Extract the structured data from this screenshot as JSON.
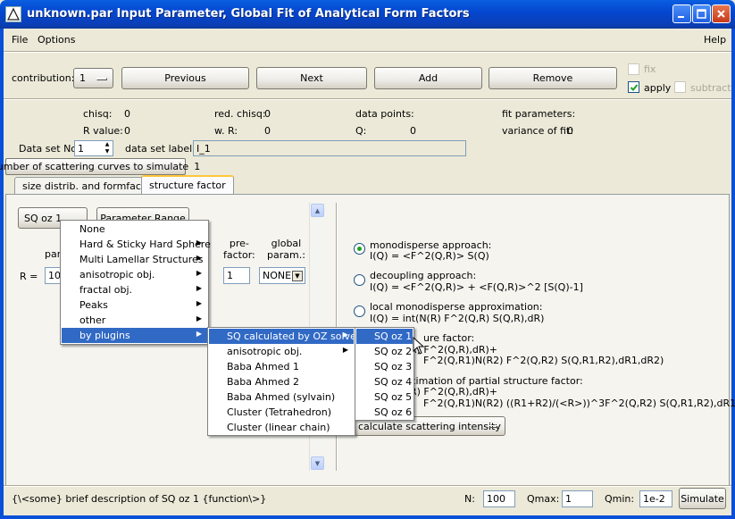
{
  "window": {
    "title": "unknown.par Input Parameter, Global Fit of Analytical Form Factors"
  },
  "menu": {
    "file": "File",
    "options": "Options",
    "help": "Help"
  },
  "top": {
    "contribution_label": "contribution:",
    "contribution_value": "1",
    "previous": "Previous",
    "next": "Next",
    "add": "Add",
    "remove": "Remove",
    "fix": "fix",
    "apply": "apply",
    "subtract": "subtract"
  },
  "stats": {
    "chisq_label": "chisq:",
    "chisq_value": "0",
    "red_chisq_label": "red. chisq:",
    "red_chisq_value": "0",
    "data_points_label": "data points:",
    "fit_parameters_label": "fit parameters:",
    "r_value_label": "R value:",
    "r_value": "0",
    "wr_label": "w. R:",
    "wr_value": "0",
    "q_label": "Q:",
    "q_value": "0",
    "variance_label": "variance of fit:",
    "variance_value": "0"
  },
  "dataset": {
    "no_label": "Data set No:",
    "no_value": "1",
    "label_label": "data set label:",
    "label_value": "I_1",
    "num_curves_label": "number of scattering curves to simulate",
    "num_curves_value": "1"
  },
  "tabs": [
    {
      "label": "size distrib. and formfactor"
    },
    {
      "label": "structure factor"
    }
  ],
  "sq": {
    "selected": "SQ oz 1",
    "parameter_range": "Parameter Range",
    "par_label_partial": "par",
    "r_label": "R =",
    "r_value": "10",
    "prefactor_label": "pre-\nfactor:",
    "prefactor_value": "1",
    "global_label": "global\nparam.:",
    "global_value": "NONE"
  },
  "menu_level1": [
    {
      "label": "None",
      "submenu": false
    },
    {
      "label": "Hard & Sticky Hard Sphere",
      "submenu": true
    },
    {
      "label": "Multi Lamellar Structures",
      "submenu": true
    },
    {
      "label": "anisotropic obj.",
      "submenu": true
    },
    {
      "label": "fractal obj.",
      "submenu": true
    },
    {
      "label": "Peaks",
      "submenu": true
    },
    {
      "label": "other",
      "submenu": true
    },
    {
      "label": "by plugins",
      "submenu": true
    }
  ],
  "menu_level2": [
    {
      "label": "SQ calculated by OZ solver",
      "submenu": true
    },
    {
      "label": "anisotropic obj.",
      "submenu": true
    },
    {
      "label": "Baba Ahmed 1",
      "submenu": false
    },
    {
      "label": "Baba Ahmed 2",
      "submenu": false
    },
    {
      "label": "Baba Ahmed (sylvain)",
      "submenu": false
    },
    {
      "label": "Cluster (Tetrahedron)",
      "submenu": false
    },
    {
      "label": "Cluster (linear chain)",
      "submenu": false
    }
  ],
  "menu_level3": [
    {
      "label": "SQ oz 1"
    },
    {
      "label": "SQ oz 2"
    },
    {
      "label": "SQ oz 3"
    },
    {
      "label": "SQ oz 4"
    },
    {
      "label": "SQ oz 5"
    },
    {
      "label": "SQ oz 6"
    }
  ],
  "approaches": {
    "mono_title": "monodisperse approach:",
    "mono_formula": "I(Q) = <F^2(Q,R)> S(Q)",
    "decoupling_title": "decoupling approach:",
    "decoupling_formula": "I(Q) = <F^2(Q,R)> + <F(Q,R)>^2 [S(Q)-1]",
    "lma_title": "local monodisperse approximation:",
    "lma_formula": "I(Q) = int(N(R) F^2(Q,R) S(Q,R),dR)",
    "psf_title_partial": "ure factor:",
    "psf_line1_partial": "R) F^2(Q,R),dR)+",
    "psf_line2_partial": "F^2(Q,R1)N(R2) F^2(Q,R2) S(Q,R1,R2),dR1,dR2)",
    "sapsf_title_partial": "ximation of partial structure factor:",
    "sapsf_line1_partial": "R) F^2(Q,R),dR)+",
    "sapsf_line2_partial": "F^2(Q,R1)N(R2) ((R1+R2)/(<R>))^3F^2(Q,R2) S(Q,R1,R2),dR1,dR2)",
    "calc_button": "calculate scattering intensity"
  },
  "bottom": {
    "description": "{\\<some} brief description of SQ oz 1 {function\\>}",
    "n_label": "N:",
    "n_value": "100",
    "qmax_label": "Qmax:",
    "qmax_value": "1",
    "qmin_label": "Qmin:",
    "qmin_value": "1e-2",
    "simulate": "Simulate"
  },
  "colors": {
    "titlebar": "#0a4fd8",
    "highlight": "#316ac5",
    "window_bg": "#ece9d8"
  },
  "icons": [
    "app-icon",
    "minimize-icon",
    "maximize-icon",
    "close-icon",
    "dropdown-arrow-icon",
    "submenu-arrow-icon",
    "checkmark-icon",
    "mouse-cursor-icon"
  ]
}
